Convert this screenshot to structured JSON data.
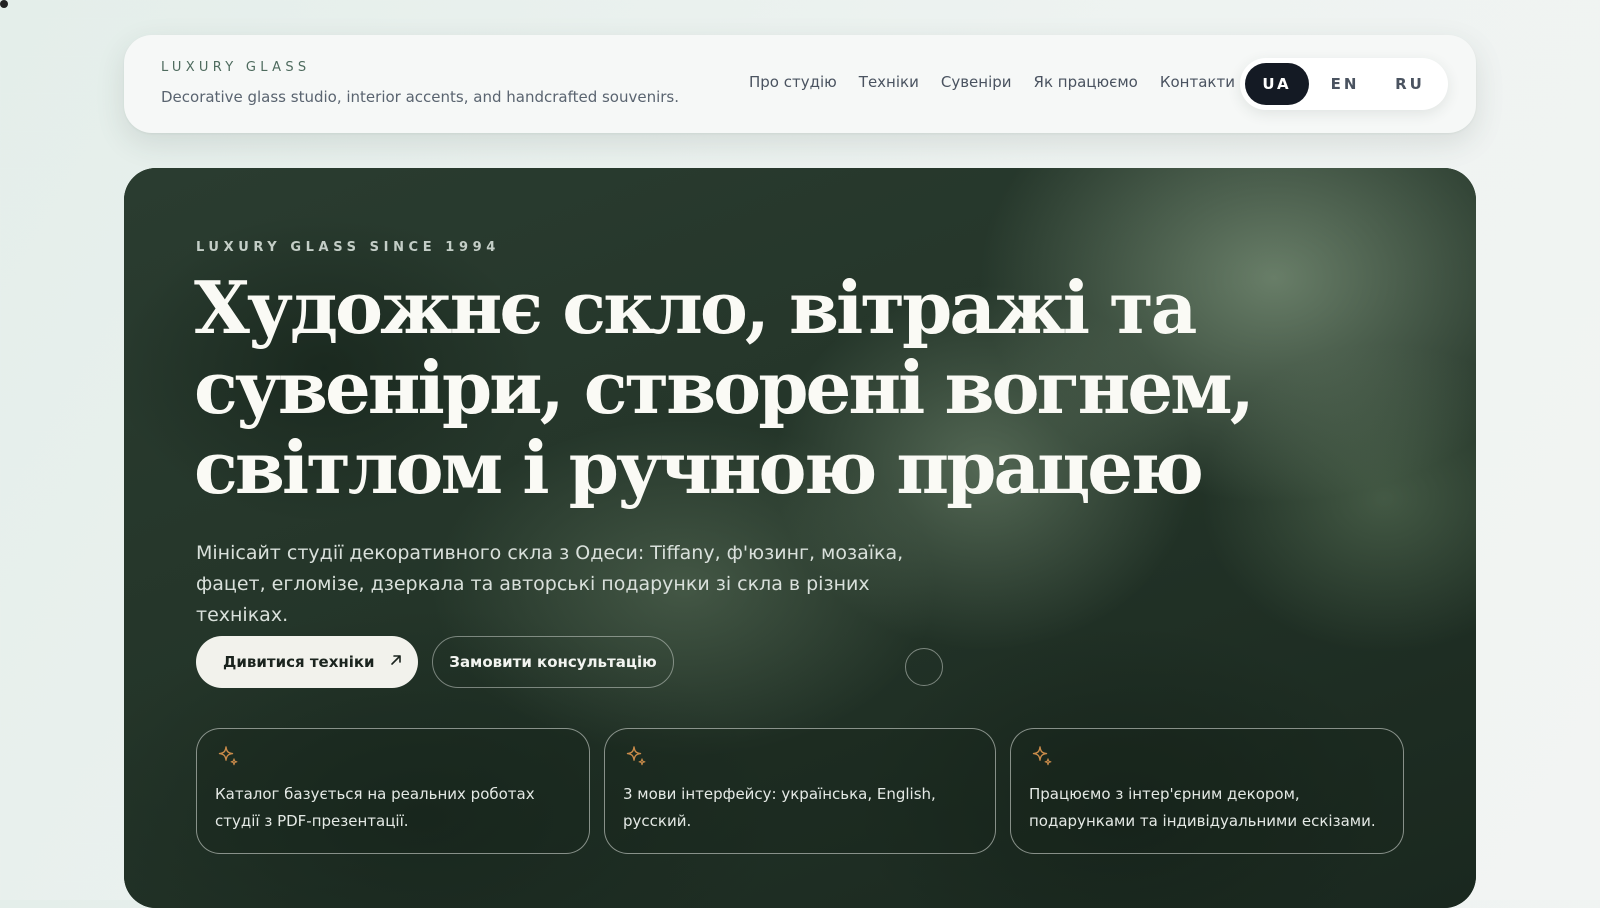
{
  "header": {
    "brand_name": "LUXURY GLASS",
    "brand_tagline": "Decorative glass studio, interior accents, and handcrafted souvenirs.",
    "nav": [
      {
        "label": "Про студію"
      },
      {
        "label": "Техніки"
      },
      {
        "label": "Сувеніри"
      },
      {
        "label": "Як працюємо"
      },
      {
        "label": "Контакти"
      }
    ],
    "languages": [
      {
        "label": "UA",
        "active": true
      },
      {
        "label": "EN",
        "active": false
      },
      {
        "label": "RU",
        "active": false
      }
    ]
  },
  "hero": {
    "eyebrow": "LUXURY GLASS SINCE 1994",
    "title": "Художнє скло, вітражі та сувеніри, створені вогнем, світлом і ручною працею",
    "lead": "Мінісайт студії декоративного скла з Одеси: Tiffany, ф'юзинг, мозаїка, фацет, егломізе, дзеркала та авторські подарунки зі скла в різних техніках.",
    "primary_button": {
      "label": "Дивитися техніки",
      "icon": "arrow-up-right-icon"
    },
    "secondary_button": {
      "label": "Замовити консультацію"
    },
    "cards": [
      {
        "icon": "sparkle-icon",
        "text": "Каталог базується на реальних роботах студії з PDF-презентації."
      },
      {
        "icon": "sparkle-icon",
        "text": "3 мови інтерфейсу: українська, English, русский."
      },
      {
        "icon": "sparkle-icon",
        "text": "Працюємо з інтер'єрним декором, подарунками та індивідуальними ескізами."
      }
    ]
  },
  "colors": {
    "page_background": "#e9f0ed",
    "header_background": "#f6f8f7",
    "brand_accent": "#4e6b5e",
    "active_language": "#141a24",
    "hero_background": "#1e2e24",
    "sparkle_accent": "#c98b4a"
  }
}
